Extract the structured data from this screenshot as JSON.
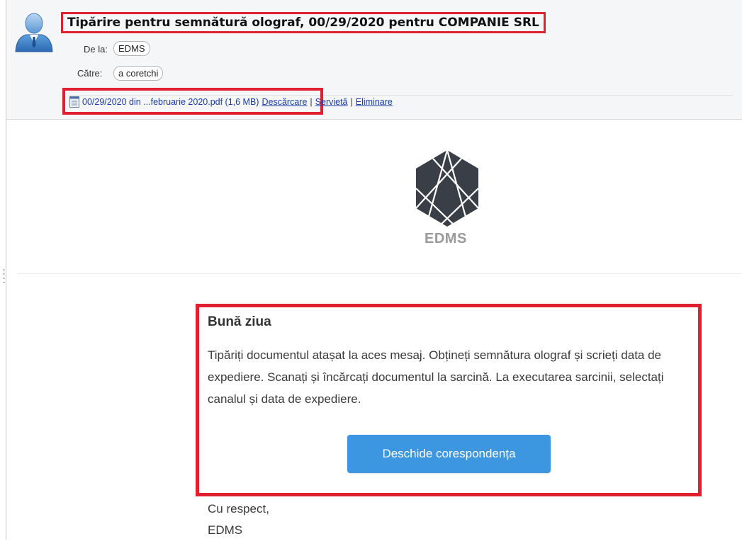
{
  "message": {
    "subject": "Tipărire pentru semnătură olograf, 00/29/2020 pentru COMPANIE SRL",
    "from_label": "De la:",
    "from_value": "EDMS",
    "to_label": "Către:",
    "to_value": "a coretchi"
  },
  "attachment": {
    "file_name": "00/29/2020 din ...februarie 2020.pdf (1,6 MB)",
    "actions": [
      "Descărcare",
      "Servietă",
      "Eliminare"
    ],
    "separator": "|"
  },
  "email_body": {
    "brand": "EDMS",
    "greeting": "Bună ziua",
    "paragraph": "Tipăriți documentul atașat la aces mesaj. Obțineți semnătura olograf și scrieți data de expediere. Scanați și încărcați documentul la sarcină. La executarea sarcinii, selectați canalul și data de expediere.",
    "button_label": "Deschide corespondența",
    "closing": "Cu respect,",
    "signature": "EDMS"
  },
  "colors": {
    "highlight": "#e0202e",
    "button": "#3d96e0",
    "link": "#1a3ca8",
    "logo": "#3a3f47"
  },
  "icons": {
    "avatar": "user-avatar-icon",
    "attachment": "pdf-file-icon",
    "logo": "edms-hexagon-logo"
  }
}
